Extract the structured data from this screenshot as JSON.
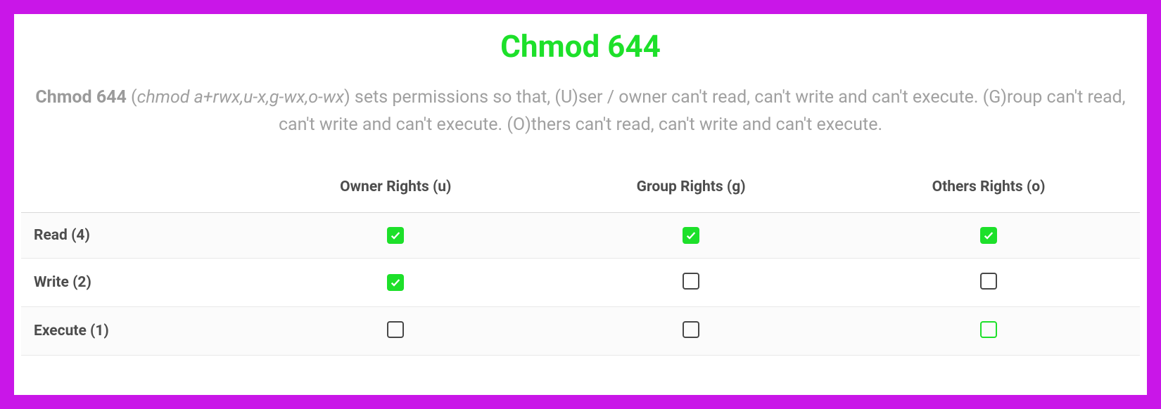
{
  "title": "Chmod 644",
  "description": {
    "bold": "Chmod 644",
    "paren_open": " (",
    "italic": "chmod a+rwx,u-x,g-wx,o-wx",
    "rest": ") sets permissions so that, (U)ser / owner can't read, can't write and can't execute. (G)roup can't read, can't write and can't execute. (O)thers can't read, can't write and can't execute."
  },
  "table": {
    "headers": [
      "",
      "Owner Rights (u)",
      "Group Rights (g)",
      "Others Rights (o)"
    ],
    "rows": [
      {
        "label": "Read (4)",
        "owner": true,
        "group": true,
        "others": true
      },
      {
        "label": "Write (2)",
        "owner": true,
        "group": false,
        "others": false
      },
      {
        "label": "Execute (1)",
        "owner": false,
        "group": false,
        "others": false,
        "others_green": true
      }
    ]
  },
  "colors": {
    "accent_green": "#1de02a",
    "border_magenta": "#c916e8",
    "text_gray": "#a0a0a0",
    "label_gray": "#4d4d4d"
  }
}
